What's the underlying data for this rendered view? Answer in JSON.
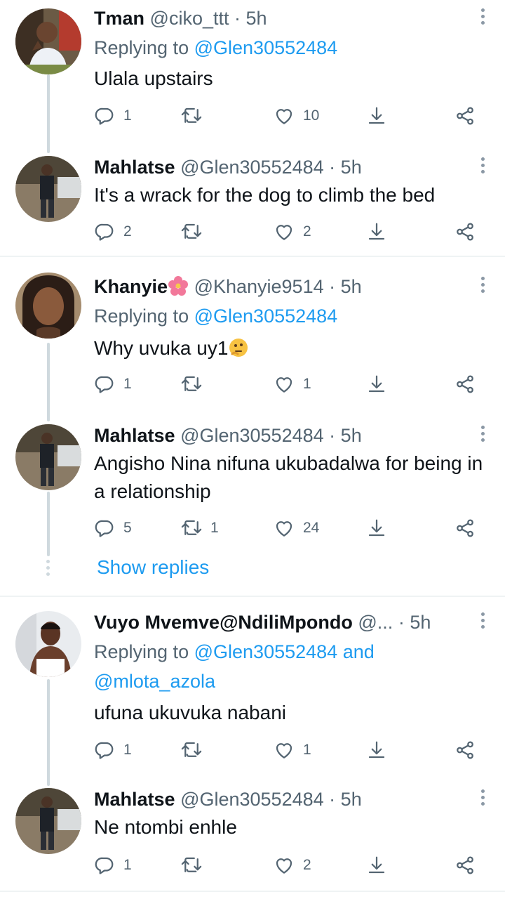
{
  "tweets": [
    {
      "name": "Tman",
      "handle": "@ciko_ttt",
      "dot": "·",
      "time": "5h",
      "reply_prefix": "Replying to",
      "reply_to": "@Glen30552484",
      "text": "Ulala upstairs",
      "replies": "1",
      "retweets": "",
      "likes": "10"
    },
    {
      "name": "Mahlatse",
      "handle": "@Glen30552484",
      "dot": "·",
      "time": "5h",
      "text": "It's a wrack for the dog to climb the bed",
      "replies": "2",
      "retweets": "",
      "likes": "2"
    },
    {
      "name": "Khanyie",
      "name_emoji": "hibiscus-flower-emoji",
      "handle": "@Khanyie9514",
      "dot": "·",
      "time": "5h",
      "reply_prefix": "Replying to",
      "reply_to": "@Glen30552484",
      "text": "Why uvuka uy1",
      "text_emoji": "thinking-face-emoji",
      "replies": "1",
      "retweets": "",
      "likes": "1"
    },
    {
      "name": "Mahlatse",
      "handle": "@Glen30552484",
      "dot": "·",
      "time": "5h",
      "text": "Angisho Nina nifuna ukubadalwa for being in a relationship",
      "replies": "5",
      "retweets": "1",
      "likes": "24"
    },
    {
      "name": "Vuyo Mvemve@NdiliMpondo",
      "handle": "@...",
      "dot": "·",
      "time": "5h",
      "reply_prefix": "Replying to",
      "reply_to": "@Glen30552484",
      "reply_and": "and",
      "reply_to_2": "@mlota_azola",
      "text": "ufuna ukuvuka nabani",
      "replies": "1",
      "retweets": "",
      "likes": "1"
    },
    {
      "name": "Mahlatse",
      "handle": "@Glen30552484",
      "dot": "·",
      "time": "5h",
      "text": "Ne ntombi enhle",
      "replies": "1",
      "retweets": "",
      "likes": "2"
    }
  ],
  "show_replies": "Show replies",
  "colors": {
    "accent": "#1d9bf0",
    "secondary_text": "#536471",
    "primary_text": "#0f1419",
    "thread_line": "#cfd9de",
    "divider": "#eff3f4"
  },
  "icons": [
    "reply-icon",
    "retweet-icon",
    "like-icon",
    "save-icon",
    "share-icon",
    "more-icon"
  ]
}
